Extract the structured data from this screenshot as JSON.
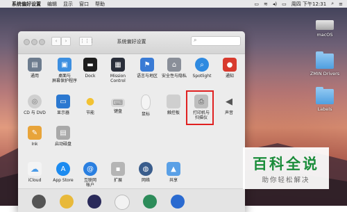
{
  "menubar": {
    "app_name": "系统偏好设置",
    "items": [
      "编辑",
      "显示",
      "窗口",
      "帮助"
    ],
    "clock": "周四 下午12:31"
  },
  "desktop_icons": [
    {
      "label": "macOS",
      "kind": "drive"
    },
    {
      "label": "ZMIN Drivers",
      "kind": "folder"
    },
    {
      "label": "Labels",
      "kind": "folder"
    }
  ],
  "window": {
    "title": "系统偏好设置",
    "panes_row1": [
      "通用",
      "桌面与\n屏幕保护程序",
      "Dock",
      "Mission\nControl",
      "语言与地区",
      "安全性与隐私",
      "Spotlight",
      "通知"
    ],
    "panes_row2": [
      "CD 与 DVD",
      "显示器",
      "节能",
      "键盘",
      "鼠标",
      "触控板",
      "打印机与\n扫描仪",
      "声音"
    ],
    "panes_row3": [
      "Ink",
      "启动磁盘"
    ],
    "panes_row4": [
      "iCloud",
      "App Store",
      "互联网\n帐户",
      "扩展",
      "网络",
      "共享"
    ],
    "highlighted_pane": "打印机与扫描仪"
  },
  "watermark": {
    "title": "百科全说",
    "subtitle": "助你轻松解决"
  },
  "colors": {
    "highlight": "#e02020",
    "watermark_green": "#1a8c3a"
  }
}
